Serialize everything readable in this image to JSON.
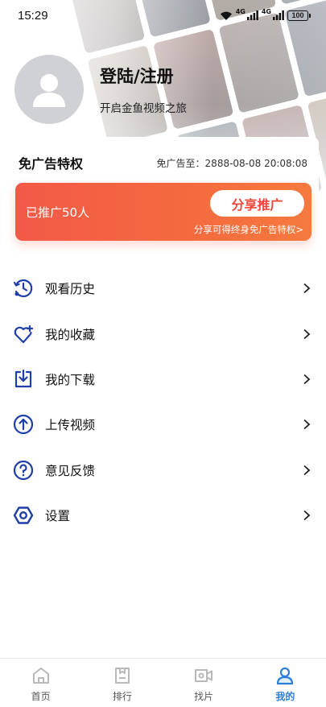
{
  "status_bar": {
    "time": "15:29",
    "network_1": "4G",
    "network_2": "4G",
    "battery": "100"
  },
  "profile": {
    "title": "登陆/注册",
    "subtitle": "开启金鱼视频之旅"
  },
  "vip": {
    "title": "免广告特权",
    "expire_text": "免广告至：2888-08-08 20:08:08",
    "promo_count": "已推广50人",
    "share_button": "分享推广",
    "share_hint": "分享可得终身免广告特权>"
  },
  "menu": {
    "items": [
      {
        "label": "观看历史",
        "icon": "history-icon"
      },
      {
        "label": "我的收藏",
        "icon": "favorite-icon"
      },
      {
        "label": "我的下载",
        "icon": "download-icon"
      },
      {
        "label": "上传视频",
        "icon": "upload-icon"
      },
      {
        "label": "意见反馈",
        "icon": "feedback-icon"
      },
      {
        "label": "设置",
        "icon": "settings-icon"
      }
    ]
  },
  "tabbar": {
    "tabs": [
      {
        "label": "首页",
        "icon": "home-icon"
      },
      {
        "label": "排行",
        "icon": "ranking-icon"
      },
      {
        "label": "找片",
        "icon": "find-video-icon"
      },
      {
        "label": "我的",
        "icon": "profile-icon",
        "active": true
      }
    ]
  },
  "colors": {
    "accent_blue": "#1f3fa8",
    "tab_active": "#2c7fd6",
    "promo_start": "#f25a48",
    "promo_end": "#f57a3e",
    "share_text": "#f0453a"
  }
}
